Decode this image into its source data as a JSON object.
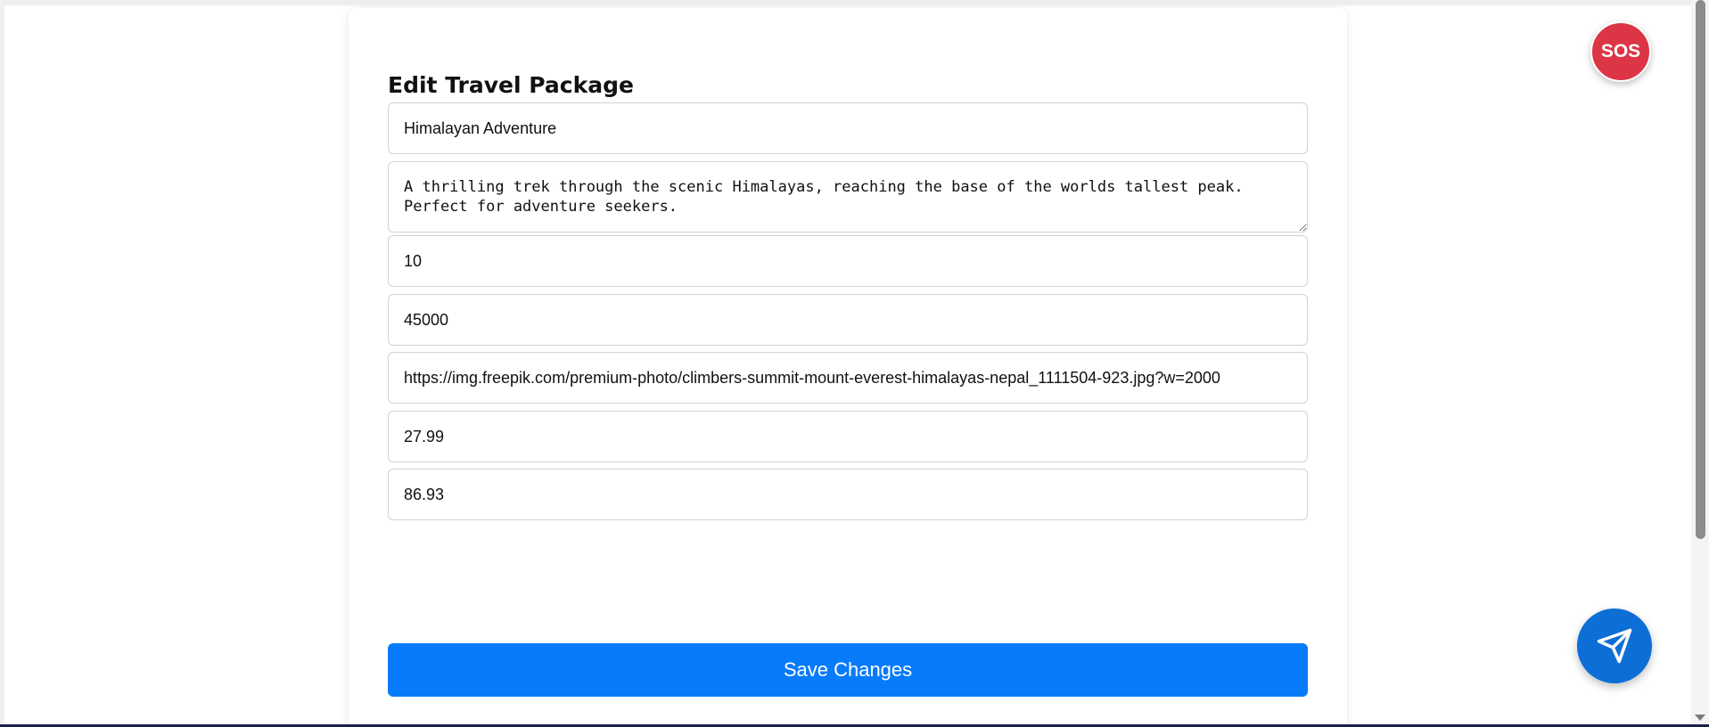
{
  "form": {
    "title": "Edit Travel Package",
    "name_value": "Himalayan Adventure",
    "description_value": "A thrilling trek through the scenic Himalayas, reaching the base of the worlds tallest peak.\nPerfect for adventure seekers.",
    "duration_value": "10",
    "price_value": "45000",
    "image_url_value": "https://img.freepik.com/premium-photo/climbers-summit-mount-everest-himalayas-nepal_1111504-923.jpg?w=2000",
    "latitude_value": "27.99",
    "longitude_value": "86.93",
    "save_label": "Save Changes"
  },
  "sos": {
    "label": "SOS"
  },
  "floating": {
    "send_icon": "paper-plane-icon"
  },
  "colors": {
    "primary": "#087bfb",
    "sos": "#dc3545",
    "send": "#0d6fd6"
  }
}
